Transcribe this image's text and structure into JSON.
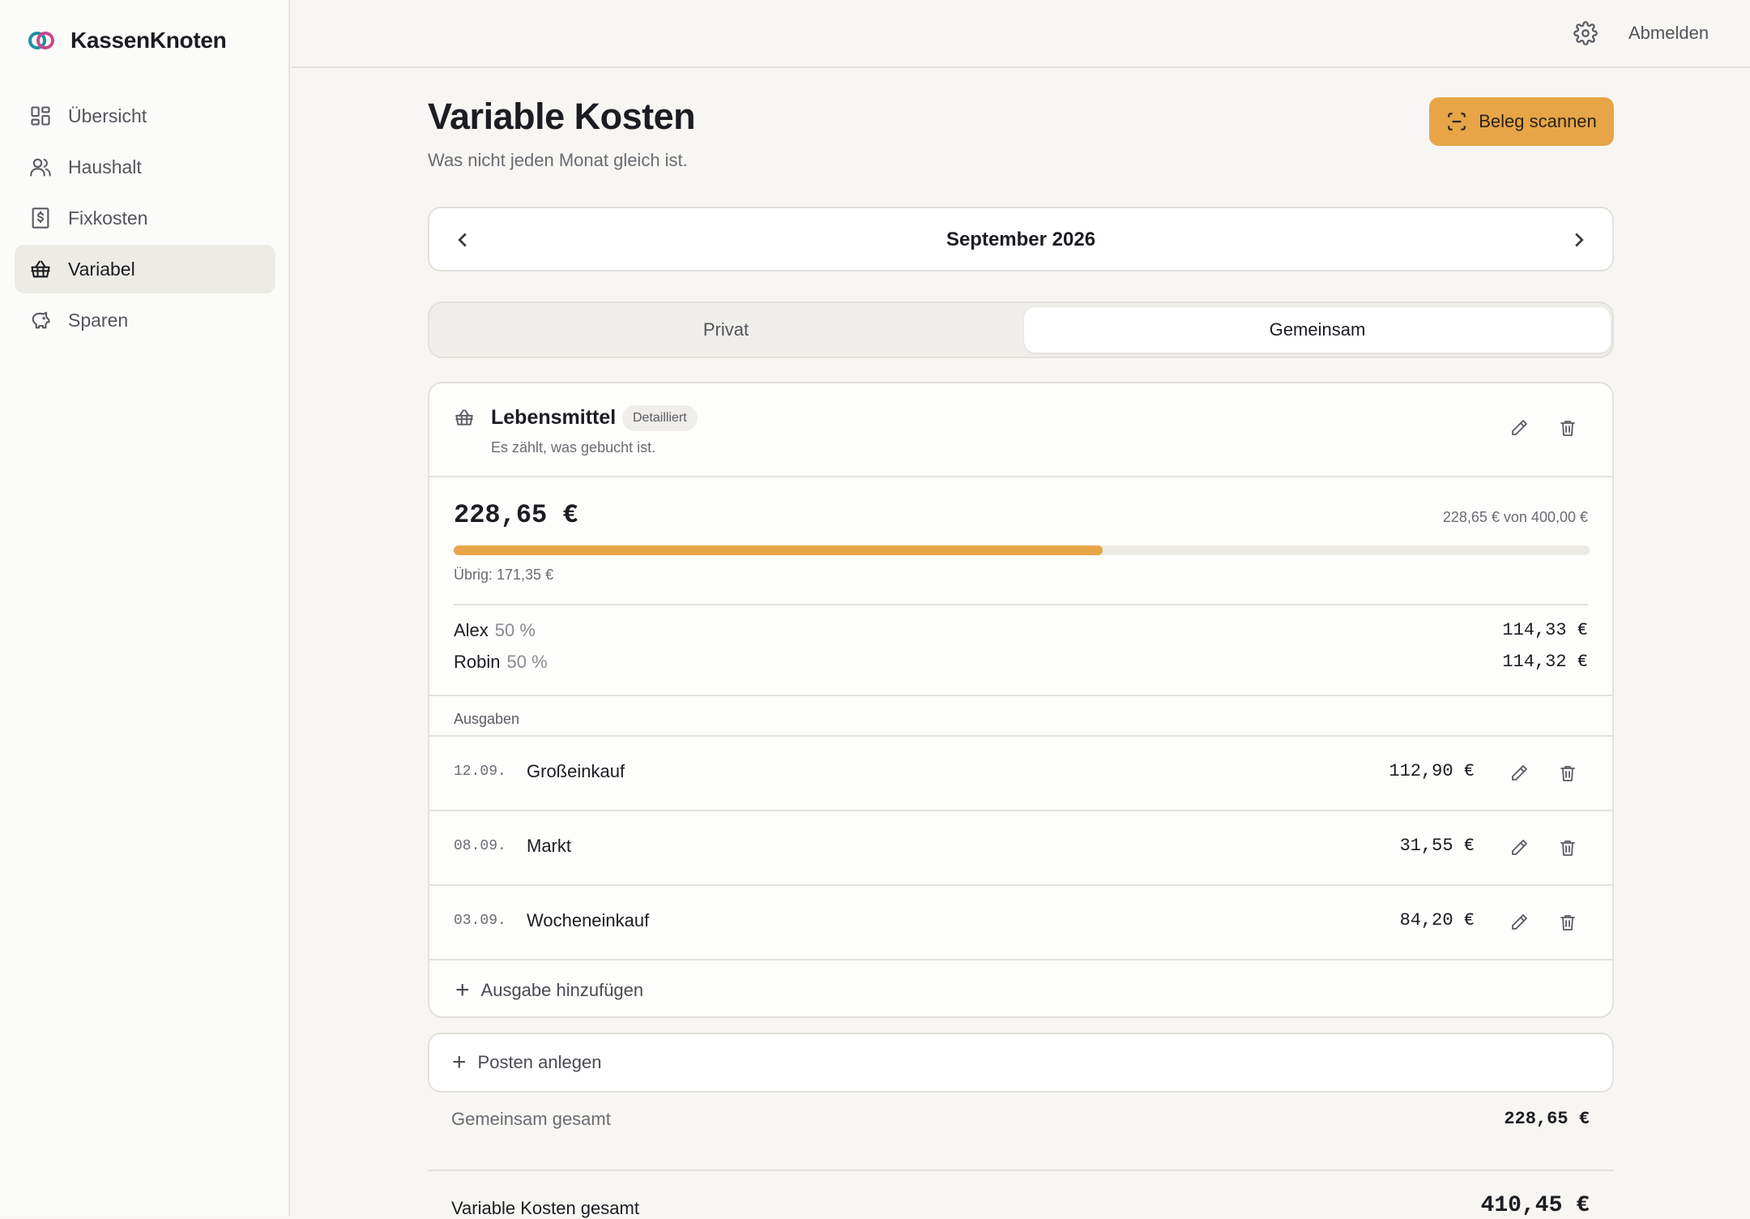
{
  "app": {
    "name": "KassenKnoten"
  },
  "sidebar": {
    "items": [
      {
        "label": "Übersicht",
        "icon": "dashboard-icon"
      },
      {
        "label": "Haushalt",
        "icon": "users-icon"
      },
      {
        "label": "Fixkosten",
        "icon": "receipt-icon"
      },
      {
        "label": "Variabel",
        "icon": "basket-icon",
        "active": true
      },
      {
        "label": "Sparen",
        "icon": "piggy-bank-icon"
      }
    ]
  },
  "topbar": {
    "settings_icon": "gear-icon",
    "logout_label": "Abmelden"
  },
  "page": {
    "title": "Variable Kosten",
    "subtitle": "Was nicht jeden Monat gleich ist.",
    "scan_button": "Beleg scannen"
  },
  "month": {
    "label": "September 2026"
  },
  "tabs": {
    "private": "Privat",
    "shared": "Gemeinsam",
    "active": "Gemeinsam"
  },
  "category": {
    "name": "Lebensmittel",
    "badge": "Detailliert",
    "subtitle": "Es zählt, was gebucht ist.",
    "amount": "228,65 €",
    "of_budget": "228,65 € von 400,00 €",
    "progress_fraction": 0.5716,
    "remaining": "Übrig: 171,35 €",
    "splits": [
      {
        "name": "Alex",
        "percent": "50 %",
        "value": "114,33 €"
      },
      {
        "name": "Robin",
        "percent": "50 %",
        "value": "114,32 €"
      }
    ],
    "expenses_label": "Ausgaben",
    "expenses": [
      {
        "date": "12.09.",
        "description": "Großeinkauf",
        "amount": "112,90 €"
      },
      {
        "date": "08.09.",
        "description": "Markt",
        "amount": "31,55 €"
      },
      {
        "date": "03.09.",
        "description": "Wocheneinkauf",
        "amount": "84,20 €"
      }
    ],
    "add_expense": "Ausgabe hinzufügen"
  },
  "add_item": "Posten anlegen",
  "totals": {
    "shared_label": "Gemeinsam gesamt",
    "shared_value": "228,65 €",
    "variable_label": "Variable Kosten gesamt",
    "variable_value": "410,45 €"
  },
  "colors": {
    "accent": "#e7a548",
    "background": "#f7f6f3"
  }
}
